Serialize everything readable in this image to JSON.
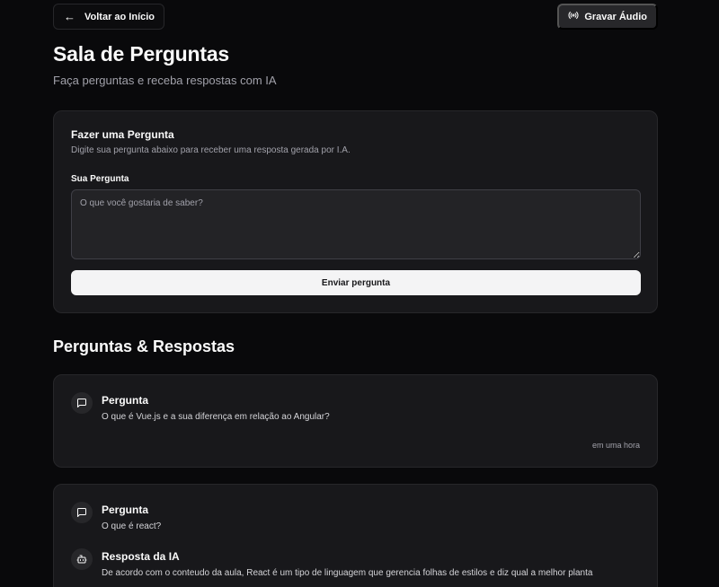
{
  "header": {
    "back_label": "Voltar ao Início",
    "record_label": "Gravar Áudio"
  },
  "page": {
    "title": "Sala de Perguntas",
    "subtitle": "Faça perguntas e receba respostas com IA"
  },
  "ask": {
    "title": "Fazer uma Pergunta",
    "description": "Digite sua pergunta abaixo para receber uma resposta gerada por I.A.",
    "field_label": "Sua Pergunta",
    "placeholder": "O que você gostaria de saber?",
    "submit_label": "Enviar pergunta"
  },
  "qa": {
    "section_title": "Perguntas & Respostas",
    "items": [
      {
        "question_label": "Pergunta",
        "question": "O que é Vue.js e a sua diferença em relação ao Angular?",
        "time": "em uma hora"
      },
      {
        "question_label": "Pergunta",
        "question": "O que é react?",
        "answer_label": "Resposta da IA",
        "answer": "De acordo com o conteudo da aula, React é um tipo de linguagem que gerencia folhas de estilos e diz qual a melhor planta"
      }
    ]
  },
  "icons": {
    "back": "arrow-left-icon",
    "record": "radio-icon",
    "question": "message-square-icon",
    "answer": "bot-icon"
  },
  "colors": {
    "background": "#09090b",
    "card": "#18181b",
    "border": "#27272a",
    "muted_text": "#a1a1aa",
    "primary_button": "#f4f4f5"
  }
}
